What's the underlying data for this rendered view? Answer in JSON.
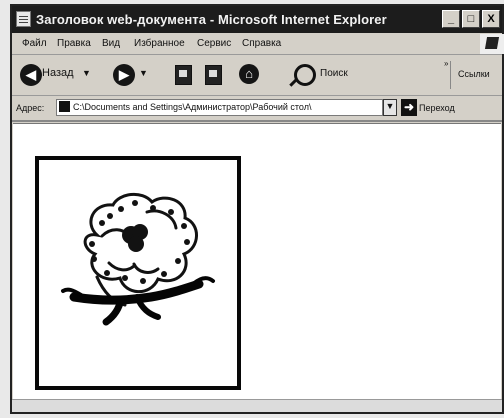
{
  "window": {
    "title": "Заголовок web-документа - Microsoft Internet Explorer",
    "controls": [
      "_",
      "□",
      "X"
    ]
  },
  "menu": [
    "Файл",
    "Правка",
    "Вид",
    "Избранное",
    "Сервис",
    "Справка"
  ],
  "toolbar": {
    "back_label": "Назад",
    "search_label": "Поиск",
    "links_label": "Ссылки"
  },
  "address": {
    "label": "Адрес:",
    "value": "C:\\Documents and Settings\\Администратор\\Рабочий стол\\",
    "go_label": "Переход"
  },
  "icons": {
    "app": "browser-icon",
    "back": "back-arrow-icon",
    "forward": "forward-arrow-icon",
    "stop": "stop-icon",
    "refresh": "refresh-icon",
    "home": "home-icon",
    "search": "search-icon",
    "address_page": "page-icon",
    "go": "go-arrow-icon"
  },
  "colors": {
    "window_frame": "#222222",
    "title_bar": "#1c1c1c",
    "chrome_gray": "#d4d0c8",
    "page_background": "#ffffff",
    "image_border": "#080808"
  }
}
